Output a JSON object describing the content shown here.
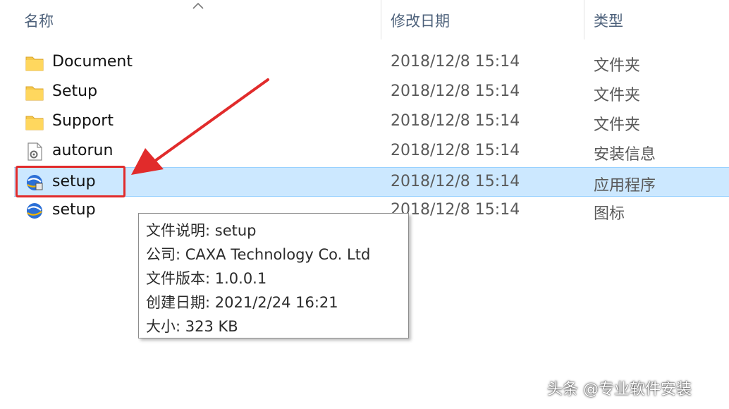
{
  "header": {
    "col_name": "名称",
    "col_date": "修改日期",
    "col_type": "类型"
  },
  "files": [
    {
      "name": "Document",
      "date": "2018/12/8 15:14",
      "type": "文件夹",
      "icon": "folder-icon",
      "selected": false
    },
    {
      "name": "Setup",
      "date": "2018/12/8 15:14",
      "type": "文件夹",
      "icon": "folder-icon",
      "selected": false
    },
    {
      "name": "Support",
      "date": "2018/12/8 15:14",
      "type": "文件夹",
      "icon": "folder-icon",
      "selected": false
    },
    {
      "name": "autorun",
      "date": "2018/12/8 15:14",
      "type": "安装信息",
      "icon": "setup-info-icon",
      "selected": false
    },
    {
      "name": "setup",
      "date": "2018/12/8 15:14",
      "type": "应用程序",
      "icon": "installer-app-icon",
      "selected": true
    },
    {
      "name": "setup",
      "date": "2018/12/8 15:14",
      "type": "图标",
      "icon": "installer-ico-icon",
      "selected": false
    }
  ],
  "tooltip": {
    "description": "文件说明: setup",
    "company": "公司: CAXA Technology Co. Ltd",
    "version": "文件版本: 1.0.0.1",
    "created": "创建日期: 2021/2/24 16:21",
    "size": "大小: 323 KB"
  },
  "watermark": "头条 @专业软件安装",
  "colors": {
    "selection_bg": "#cce8ff",
    "highlight_red": "#e12b2b",
    "header_text": "#4c607a"
  }
}
